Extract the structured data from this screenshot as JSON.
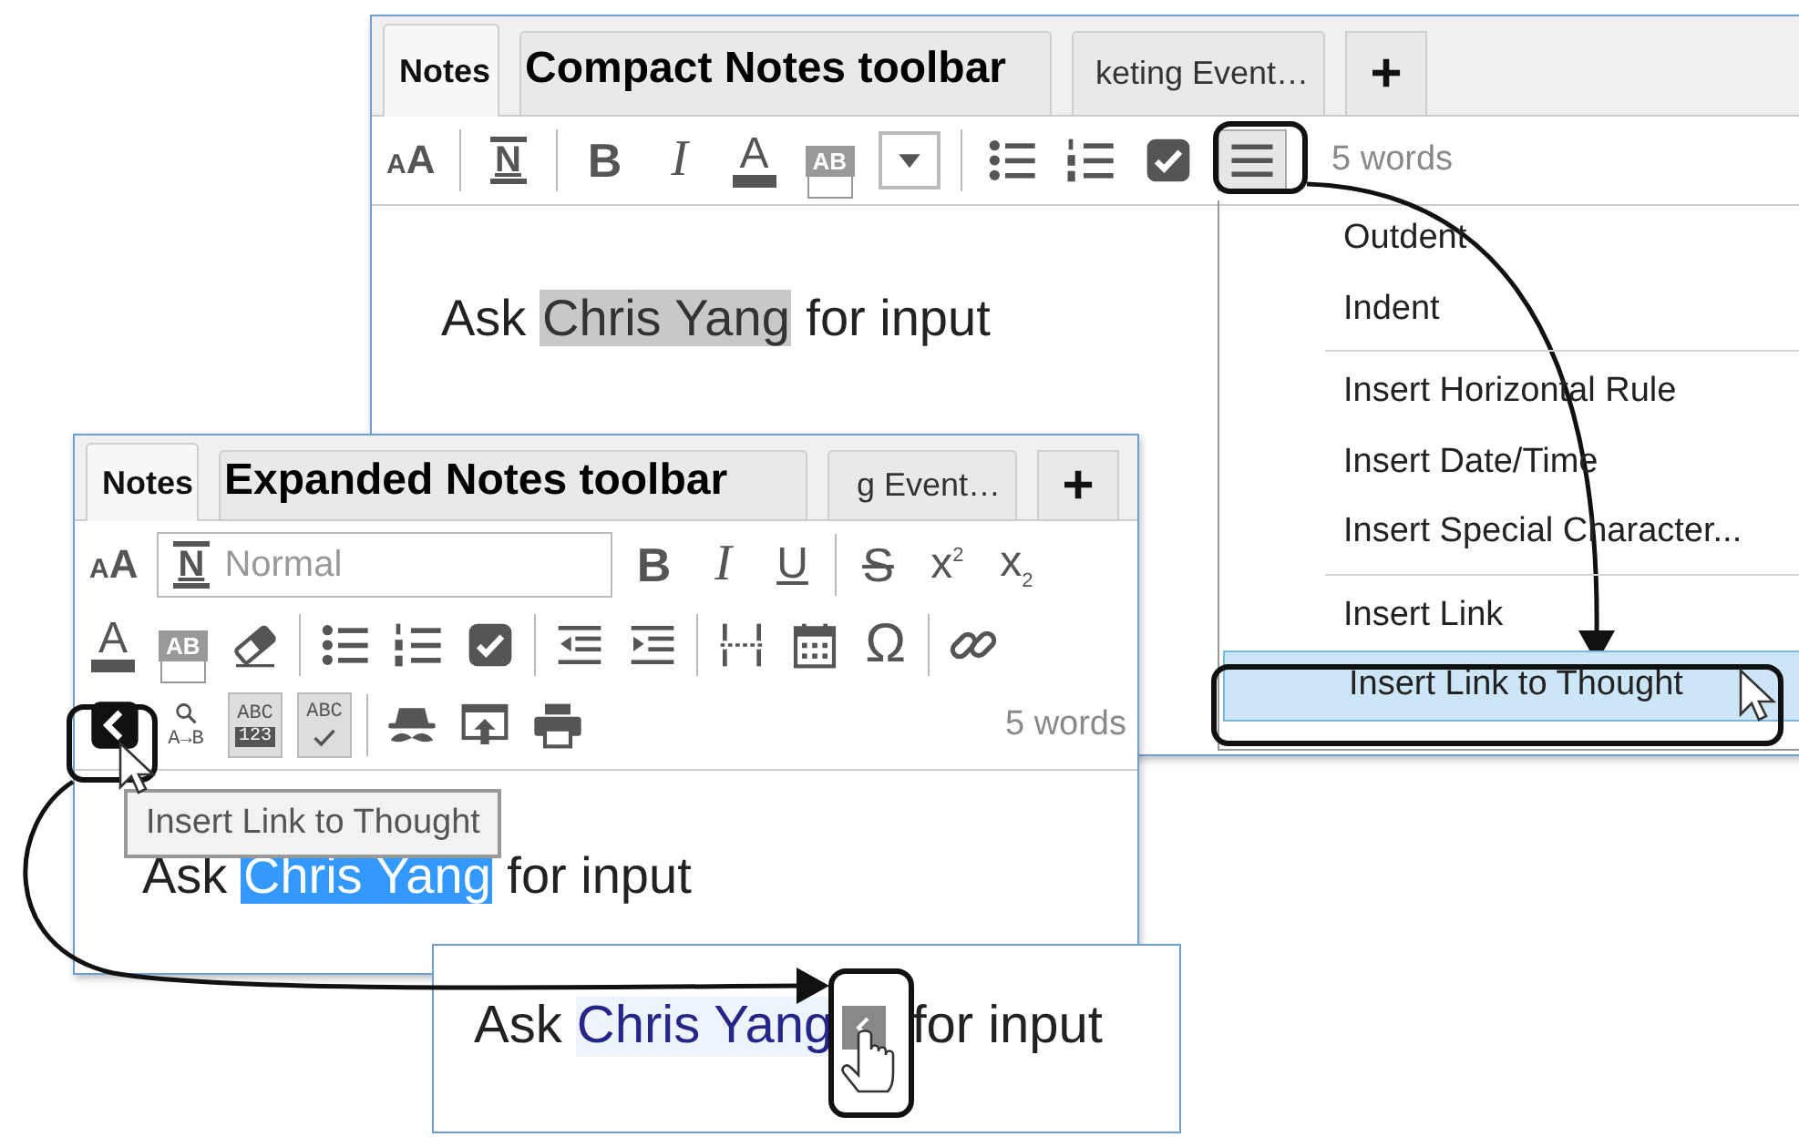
{
  "compact_window": {
    "caption": "Compact Notes toolbar",
    "tabs": [
      {
        "label": "Notes",
        "selected": true
      },
      {
        "selected": false
      },
      {
        "label": "keting Event…",
        "selected": false
      }
    ],
    "new_tab_button": "+",
    "toolbar_rows": [
      [
        {
          "kind": "fontsize",
          "glyph": "AA"
        },
        {
          "kind": "separator"
        },
        {
          "kind": "style",
          "glyph": "N"
        },
        {
          "kind": "separator"
        },
        {
          "kind": "bold",
          "glyph": "B"
        },
        {
          "kind": "italic",
          "glyph": "I"
        },
        {
          "kind": "fontcolor",
          "glyph": "A"
        },
        {
          "kind": "highlight",
          "glyph": "AB"
        },
        {
          "kind": "dropdown"
        },
        {
          "kind": "separator"
        },
        {
          "kind": "bullets"
        },
        {
          "kind": "numbered"
        },
        {
          "kind": "checkbox"
        },
        {
          "kind": "menu"
        },
        {
          "kind": "word_count",
          "text": "5 words"
        }
      ]
    ],
    "note": {
      "before": "Ask ",
      "selected_text": "Chris Yang",
      "after": " for input",
      "selection_focused": false
    }
  },
  "menu": {
    "groups": [
      {
        "items": [
          {
            "label": "Outdent",
            "selected": false
          },
          {
            "label": "Indent",
            "selected": false
          }
        ]
      },
      {
        "items": [
          {
            "label": "Insert Horizontal Rule",
            "selected": false
          },
          {
            "label": "Insert Date/Time",
            "selected": false
          },
          {
            "label": "Insert Special Character...",
            "selected": false
          }
        ]
      },
      {
        "items": [
          {
            "label": "Insert Link",
            "selected": false
          },
          {
            "label": "Insert Link to Thought",
            "selected": true
          }
        ]
      }
    ]
  },
  "expanded_window": {
    "caption": "Expanded Notes toolbar",
    "tabs": [
      {
        "label": "Notes",
        "selected": true
      },
      {
        "selected": false
      },
      {
        "label": "g Event…",
        "selected": false
      }
    ],
    "new_tab_button": "+",
    "toolbar_rows": [
      [
        {
          "kind": "fontsize",
          "glyph": "AA"
        },
        {
          "kind": "style_field",
          "glyph": "N",
          "value": "Normal"
        },
        {
          "kind": "bold",
          "glyph": "B"
        },
        {
          "kind": "italic",
          "glyph": "I"
        },
        {
          "kind": "underline",
          "glyph": "U"
        },
        {
          "kind": "separator"
        },
        {
          "kind": "strike",
          "glyph": "S"
        },
        {
          "kind": "super",
          "glyph": "x$^{2}$"
        },
        {
          "kind": "sub",
          "glyph": "x$_{2}$"
        }
      ],
      [
        {
          "kind": "fontcolor",
          "glyph": "A"
        },
        {
          "kind": "highlight",
          "glyph": "AB"
        },
        {
          "kind": "eraser"
        },
        {
          "kind": "separator"
        },
        {
          "kind": "bullets"
        },
        {
          "kind": "numbered"
        },
        {
          "kind": "checkbox"
        },
        {
          "kind": "separator"
        },
        {
          "kind": "outdent"
        },
        {
          "kind": "indent"
        },
        {
          "kind": "separator"
        },
        {
          "kind": "hrule"
        },
        {
          "kind": "calendar"
        },
        {
          "kind": "symbol",
          "glyph": "Ω"
        },
        {
          "kind": "separator"
        },
        {
          "kind": "link"
        }
      ],
      [
        {
          "kind": "thought_link"
        },
        {
          "kind": "find_replace",
          "glyph": "A→B"
        },
        {
          "kind": "spell_number",
          "glyph": "ABC",
          "sub": "123"
        },
        {
          "kind": "spellcheck",
          "glyph": "ABC"
        },
        {
          "kind": "separator"
        },
        {
          "kind": "incognito"
        },
        {
          "kind": "export"
        },
        {
          "kind": "print"
        },
        {
          "kind": "word_count",
          "text": "5 words"
        }
      ]
    ],
    "tooltip": "Insert Link to Thought",
    "note": {
      "before": "Ask ",
      "selected_text": "Chris Yang",
      "after": " for input",
      "selection_focused": true
    }
  },
  "result": {
    "before": "Ask ",
    "link": "Chris Yang",
    "after": " for input"
  }
}
